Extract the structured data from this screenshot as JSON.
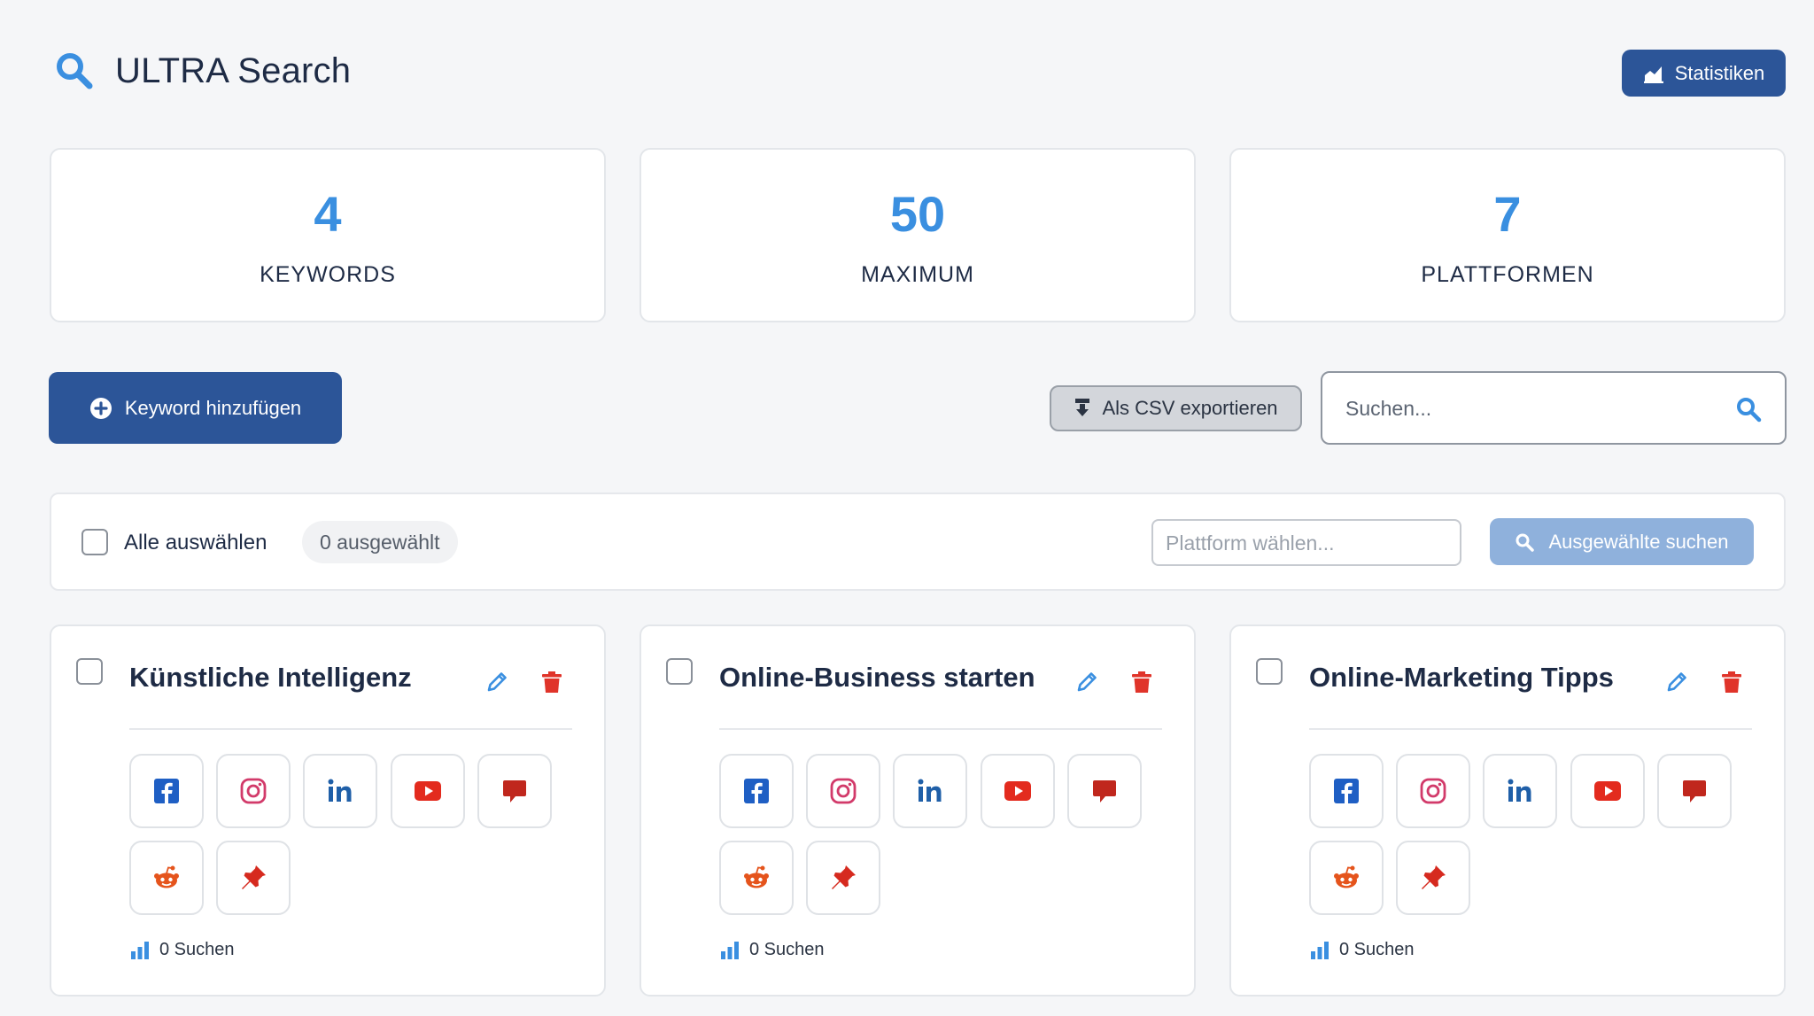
{
  "header": {
    "app_title": "ULTRA Search",
    "statistics_button": "Statistiken"
  },
  "stats": [
    {
      "value": "4",
      "label": "KEYWORDS"
    },
    {
      "value": "50",
      "label": "MAXIMUM"
    },
    {
      "value": "7",
      "label": "PLATTFORMEN"
    }
  ],
  "toolbar": {
    "add_keyword_button": "Keyword hinzufügen",
    "csv_export_button": "Als CSV exportieren",
    "search_placeholder": "Suchen..."
  },
  "selection": {
    "select_all_label": "Alle auswählen",
    "selected_count": "0 ausgewählt",
    "platform_placeholder": "Plattform wählen...",
    "search_selected_button": "Ausgewählte suchen"
  },
  "keywords": [
    {
      "title": "Künstliche Intelligenz",
      "searches": "0 Suchen"
    },
    {
      "title": "Online-Business starten",
      "searches": "0 Suchen"
    },
    {
      "title": "Online-Marketing Tipps",
      "searches": "0 Suchen"
    }
  ],
  "platforms": [
    {
      "name": "Facebook",
      "icon": "facebook-icon",
      "color": "#1f5fc4"
    },
    {
      "name": "Instagram",
      "icon": "instagram-icon",
      "color": "#d23a6a"
    },
    {
      "name": "LinkedIn",
      "icon": "linkedin-icon",
      "color": "#1f5fa8"
    },
    {
      "name": "YouTube",
      "icon": "youtube-icon",
      "color": "#e32b1e"
    },
    {
      "name": "Kommentar",
      "icon": "comment-icon",
      "color": "#c0271d"
    },
    {
      "name": "Reddit",
      "icon": "reddit-icon",
      "color": "#e5541c"
    },
    {
      "name": "Pinterest",
      "icon": "pushpin-icon",
      "color": "#d62a1f"
    }
  ],
  "colors": {
    "primary": "#2c5598",
    "accent_number": "#3a8fe0",
    "delete": "#e0342a",
    "edit": "#3a8fe0"
  }
}
